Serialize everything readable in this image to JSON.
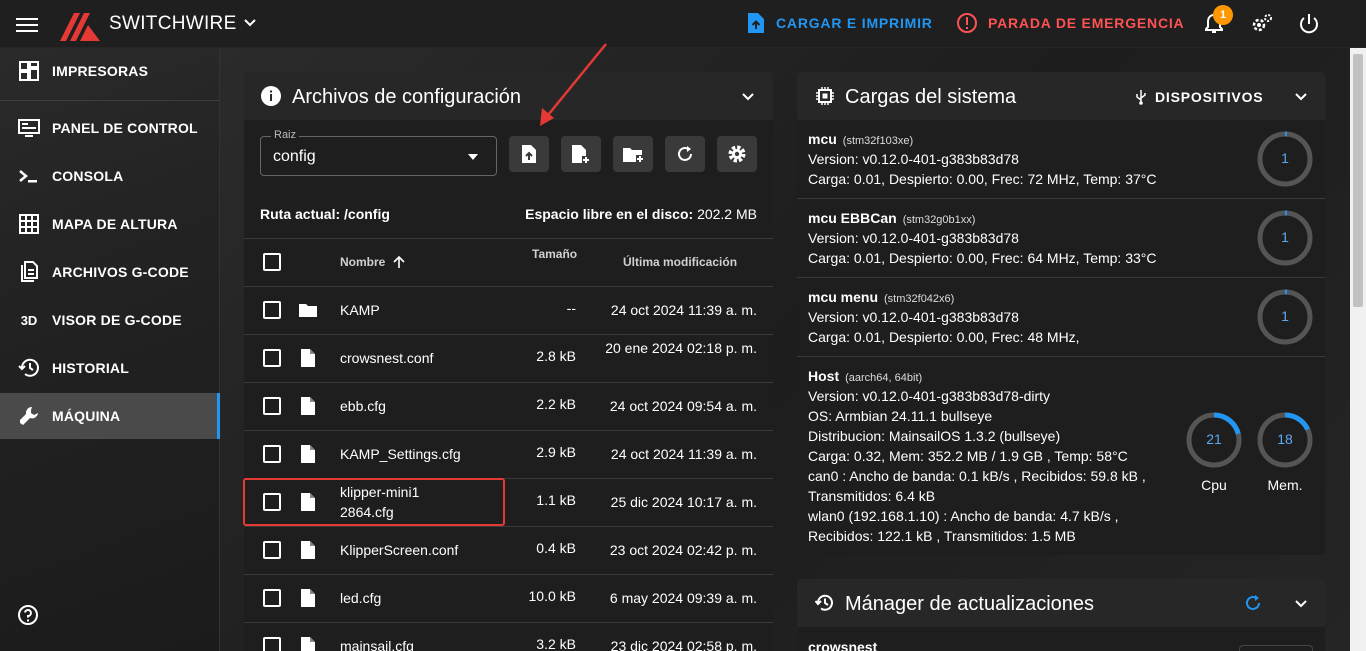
{
  "topbar": {
    "brand": "SWITCHWIRE",
    "upload_label": "CARGAR E IMPRIMIR",
    "emergency_label": "PARADA DE EMERGENCIA",
    "notification_count": "1",
    "accent_color": "#2196f3",
    "emergency_color": "#ff5252"
  },
  "sidebar": {
    "items": [
      {
        "label": "IMPRESORAS",
        "icon": "printers-grid-icon"
      },
      {
        "label": "PANEL DE CONTROL",
        "icon": "monitor-dashboard-icon"
      },
      {
        "label": "CONSOLA",
        "icon": "console-prompt-icon"
      },
      {
        "label": "MAPA DE ALTURA",
        "icon": "grid-heightmap-icon"
      },
      {
        "label": "ARCHIVOS G-CODE",
        "icon": "file-document-icon"
      },
      {
        "label": "VISOR DE G-CODE",
        "icon": "3d-viewer-icon",
        "glyph": "3D"
      },
      {
        "label": "HISTORIAL",
        "icon": "history-icon"
      },
      {
        "label": "MÁQUINA",
        "icon": "wrench-icon",
        "active": true
      }
    ]
  },
  "files": {
    "title": "Archivos de configuración",
    "root_label": "Raiz",
    "root_value": "config",
    "current_path_label": "Ruta actual: /config",
    "free_space_label": "Espacio libre en el disco:",
    "free_space_value": "202.2 MB",
    "columns": {
      "name": "Nombre",
      "size": "Tamaño",
      "modified": "Última modificación"
    },
    "rows": [
      {
        "name": "KAMP",
        "size": "--",
        "date": "24 oct 2024 11:39 a. m.",
        "type": "folder"
      },
      {
        "name": "crowsnest.conf",
        "size": "2.8 kB",
        "date": "20 ene 2024 02:18 p. m.",
        "type": "file"
      },
      {
        "name": "ebb.cfg",
        "size": "2.2 kB",
        "date": "24 oct 2024 09:54 a. m.",
        "type": "file"
      },
      {
        "name": "KAMP_Settings.cfg",
        "size": "2.9 kB",
        "date": "24 oct 2024 11:39 a. m.",
        "type": "file"
      },
      {
        "name": "klipper-mini12864.cfg",
        "size": "1.1 kB",
        "date": "25 dic 2024 10:17 a. m.",
        "type": "file"
      },
      {
        "name": "KlipperScreen.conf",
        "size": "0.4 kB",
        "date": "23 oct 2024 02:42 p. m.",
        "type": "file"
      },
      {
        "name": "led.cfg",
        "size": "10.0 kB",
        "date": "6 may 2024 09:39 a. m.",
        "type": "file"
      },
      {
        "name": "mainsail.cfg",
        "size": "3.2 kB",
        "date": "23 dic 2024 02:58 p. m.",
        "type": "file"
      }
    ]
  },
  "loads": {
    "title": "Cargas del sistema",
    "devices_label": "DISPOSITIVOS",
    "mcus": [
      {
        "name": "mcu",
        "chip": "(stm32f103xe)",
        "version": "Version: v0.12.0-401-g383b83d78",
        "load": "Carga: 0.01, Despierto: 0.00, Frec: 72 MHz, Temp: 37°C",
        "gauge": "1",
        "gauge_fraction": 0.01
      },
      {
        "name": "mcu EBBCan",
        "chip": "(stm32g0b1xx)",
        "version": "Version: v0.12.0-401-g383b83d78",
        "load": "Carga: 0.01, Despierto: 0.00, Frec: 64 MHz, Temp: 33°C",
        "gauge": "1",
        "gauge_fraction": 0.01
      },
      {
        "name": "mcu menu",
        "chip": "(stm32f042x6)",
        "version": "Version: v0.12.0-401-g383b83d78",
        "load": "Carga: 0.01, Despierto: 0.00, Frec: 48 MHz,",
        "gauge": "1",
        "gauge_fraction": 0.01
      }
    ],
    "host": {
      "name": "Host",
      "chip": "(aarch64, 64bit)",
      "lines": [
        "Version: v0.12.0-401-g383b83d78-dirty",
        "OS: Armbian 24.11.1 bullseye",
        "Distribucion: MainsailOS 1.3.2 (bullseye)",
        "Carga: 0.32, Mem: 352.2 MB / 1.9 GB , Temp: 58°C",
        "can0 : Ancho de banda: 0.1 kB/s , Recibidos: 59.8 kB ,",
        "Transmitidos: 6.4 kB",
        "wlan0 (192.168.1.10) : Ancho de banda: 4.7 kB/s ,",
        "Recibidos: 122.1 kB , Transmitidos: 1.5 MB"
      ],
      "cpu_value": "21",
      "cpu_label": "Cpu",
      "cpu_fraction": 0.21,
      "mem_value": "18",
      "mem_label": "Mem.",
      "mem_fraction": 0.18
    }
  },
  "updates": {
    "title": "Mánager de actualizaciones",
    "first_item": "crowsnest"
  }
}
